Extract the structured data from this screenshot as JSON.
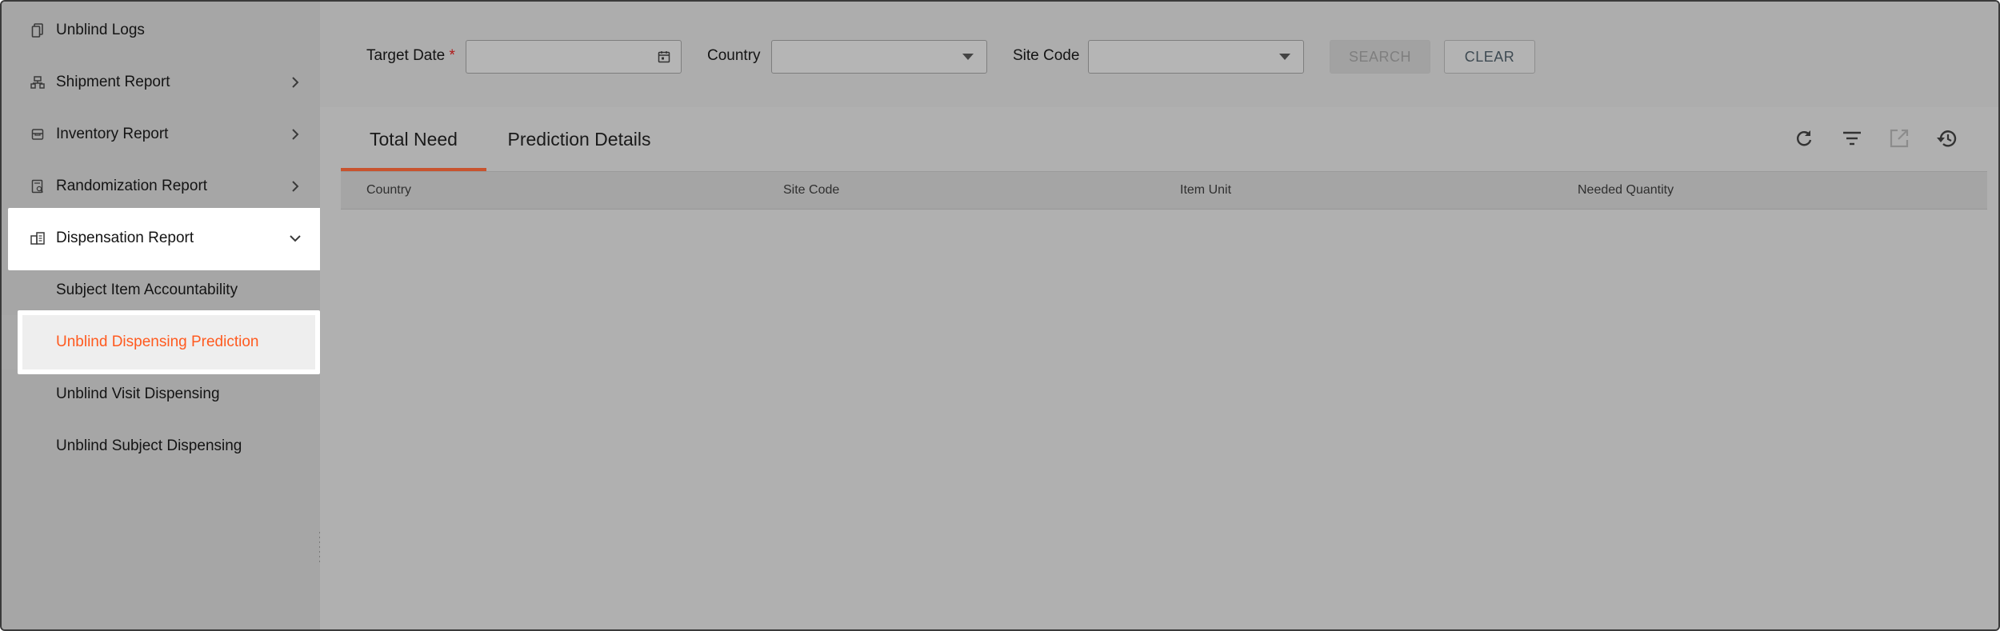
{
  "sidebar": {
    "items": [
      {
        "label": "Unblind Logs",
        "icon": "document-copy-icon"
      },
      {
        "label": "Shipment Report",
        "icon": "shipment-icon",
        "chevron": "chevron-right-icon"
      },
      {
        "label": "Inventory Report",
        "icon": "inventory-box-icon",
        "chevron": "chevron-right-icon"
      },
      {
        "label": "Randomization Report",
        "icon": "randomization-report-icon",
        "chevron": "chevron-right-icon"
      },
      {
        "label": "Dispensation Report",
        "icon": "dispensation-report-icon",
        "chevron": "chevron-down-icon"
      }
    ],
    "sub_items": [
      {
        "label": "Subject Item Accountability"
      },
      {
        "label": "Unblind Dispensing Prediction"
      },
      {
        "label": "Unblind Visit Dispensing"
      },
      {
        "label": "Unblind Subject Dispensing"
      }
    ],
    "collapse_icon": "collapse-sidebar-icon"
  },
  "filters": {
    "target_date_label": "Target Date",
    "required_mark": "*",
    "target_date_value": "",
    "target_date_icon": "calendar-icon",
    "country_label": "Country",
    "country_value": "",
    "site_code_label": "Site Code",
    "site_code_value": "",
    "dropdown_icon": "caret-down-icon",
    "search_label": "SEARCH",
    "clear_label": "CLEAR"
  },
  "tabs": [
    {
      "label": "Total Need",
      "active": true
    },
    {
      "label": "Prediction Details",
      "active": false
    }
  ],
  "toolbar": {
    "icons": [
      "refresh-icon",
      "filter-icon",
      "export-icon",
      "history-icon"
    ]
  },
  "table": {
    "columns": [
      "Country",
      "Site Code",
      "Item Unit",
      "Needed Quantity"
    ],
    "rows": []
  },
  "colors": {
    "accent": "#ff5a1f",
    "active_tab_underline": "#c8532e",
    "overlay": "#b0b0b0"
  }
}
